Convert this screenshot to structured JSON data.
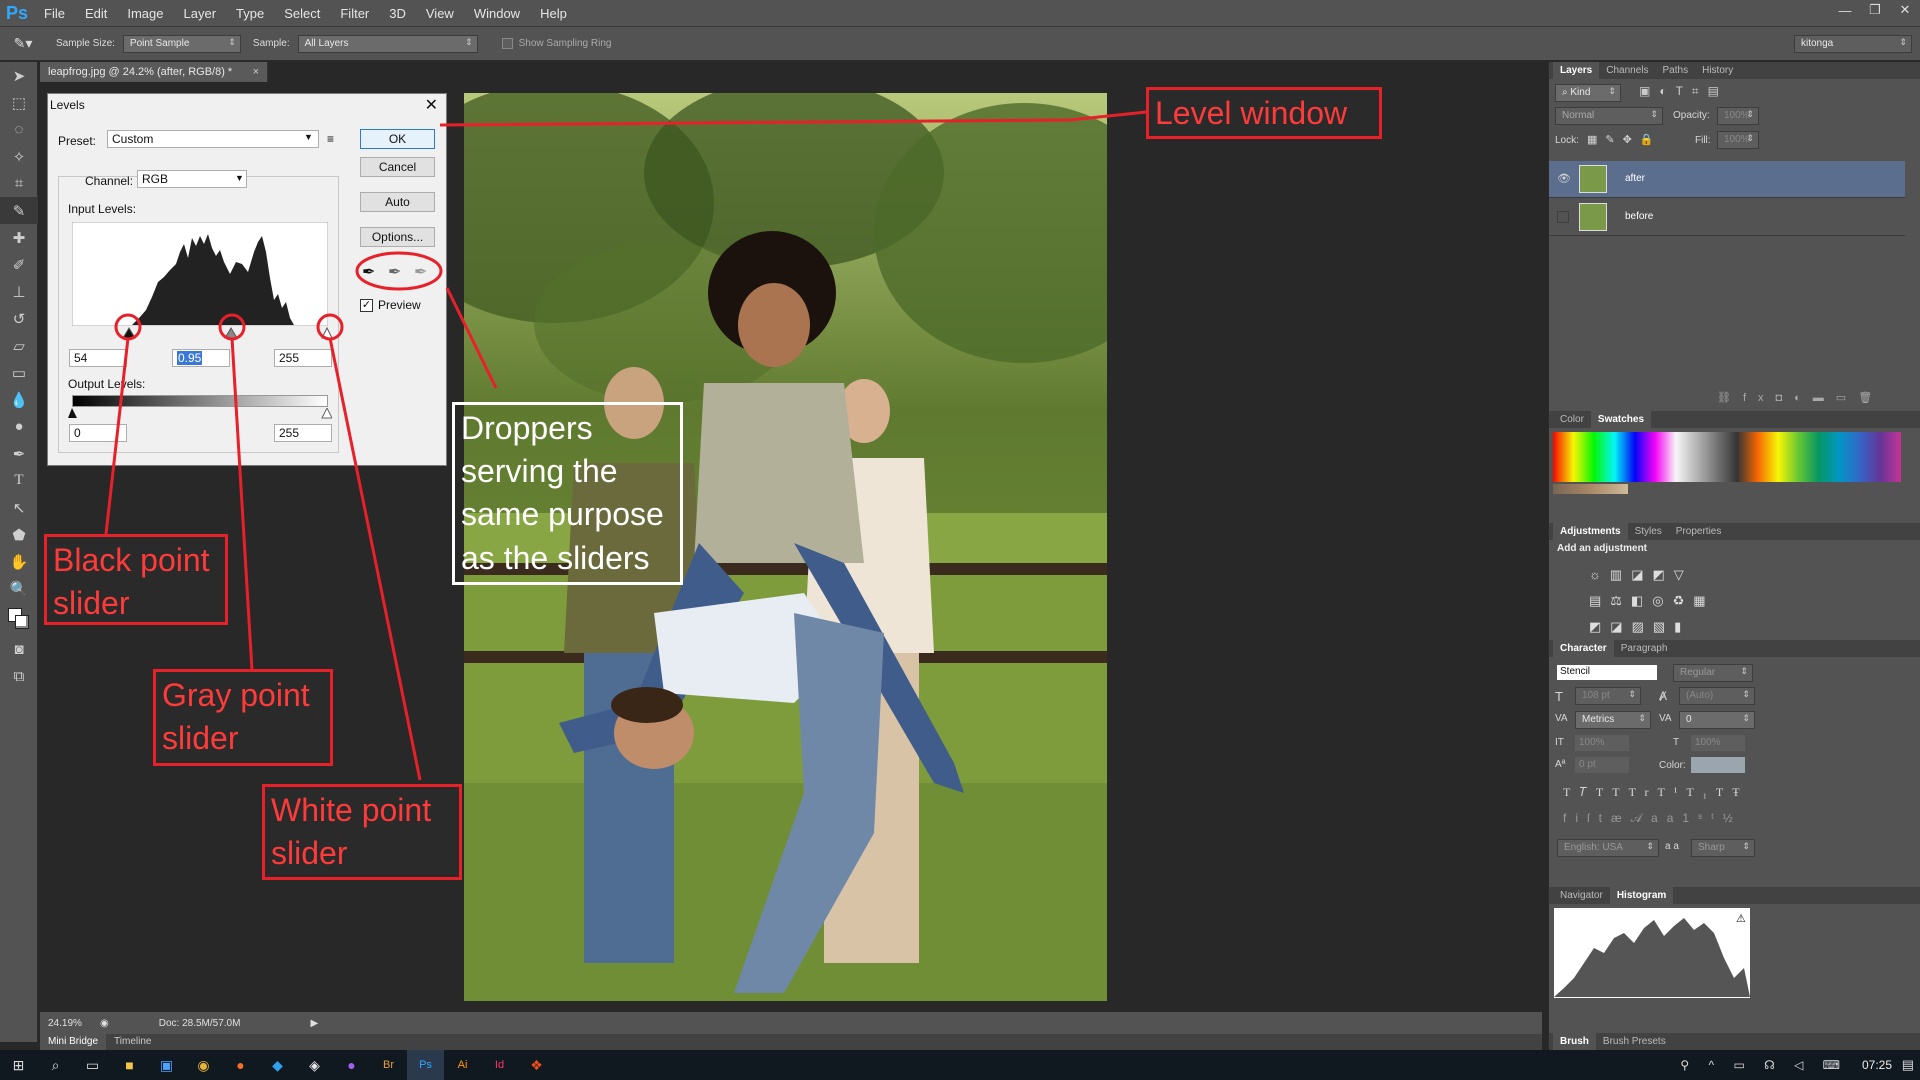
{
  "app": {
    "logo": "Ps"
  },
  "menu": [
    "File",
    "Edit",
    "Image",
    "Layer",
    "Type",
    "Select",
    "Filter",
    "3D",
    "View",
    "Window",
    "Help"
  ],
  "window_controls": [
    "—",
    "❐",
    "✕"
  ],
  "options_bar": {
    "sample_size_label": "Sample Size:",
    "sample_size_value": "Point Sample",
    "sample_label": "Sample:",
    "sample_value": "All Layers",
    "show_ring_label": "Show Sampling Ring",
    "workspace": "kitonga"
  },
  "document": {
    "tab_title": "leapfrog.jpg @ 24.2% (after, RGB/8) *",
    "tab_close": "×"
  },
  "status": {
    "zoom": "24.19%",
    "doc": "Doc: 28.5M/57.0M"
  },
  "bottom_tabs": [
    "Mini Bridge",
    "Timeline"
  ],
  "levels": {
    "title": "Levels",
    "preset_label": "Preset:",
    "preset_value": "Custom",
    "channel_label": "Channel:",
    "channel_value": "RGB",
    "input_levels_label": "Input Levels:",
    "input_black": "54",
    "input_gray": "0.95",
    "input_white": "255",
    "output_levels_label": "Output Levels:",
    "output_black": "0",
    "output_white": "255",
    "ok": "OK",
    "cancel": "Cancel",
    "auto": "Auto",
    "options": "Options...",
    "preview_label": "Preview",
    "preview_checked": true
  },
  "annotations": {
    "level_window": "Level window",
    "droppers": "Droppers serving the same purpose as the sliders",
    "black_point": "Black point slider",
    "gray_point": "Gray point slider",
    "white_point": "White point slider",
    "color": "#e8202a"
  },
  "layers_panel": {
    "tabs": [
      "Layers",
      "Channels",
      "Paths",
      "History"
    ],
    "kind": "Kind",
    "blend_mode": "Normal",
    "opacity_label": "Opacity:",
    "opacity_value": "100%",
    "lock_label": "Lock:",
    "fill_label": "Fill:",
    "fill_value": "100%",
    "layers": [
      {
        "name": "after",
        "selected": true
      },
      {
        "name": "before",
        "selected": false
      }
    ]
  },
  "swatches_panel": {
    "tabs": [
      "Color",
      "Swatches"
    ]
  },
  "adjustments_panel": {
    "tabs": [
      "Adjustments",
      "Styles",
      "Properties"
    ],
    "title": "Add an adjustment"
  },
  "character_panel": {
    "tabs": [
      "Character",
      "Paragraph"
    ],
    "font_family": "Stencil",
    "font_style": "Regular",
    "size": "108 pt",
    "leading": "(Auto)",
    "kerning": "Metrics",
    "tracking": "0",
    "vscale": "100%",
    "hscale": "100%",
    "baseline": "0 pt",
    "color_label": "Color:",
    "language": "English: USA",
    "aa_label": "a a",
    "antialias": "Sharp"
  },
  "histogram_panel": {
    "tabs": [
      "Navigator",
      "Histogram"
    ]
  },
  "brush_tabs": [
    "Brush",
    "Brush Presets"
  ],
  "taskbar": {
    "time": "07:25"
  }
}
